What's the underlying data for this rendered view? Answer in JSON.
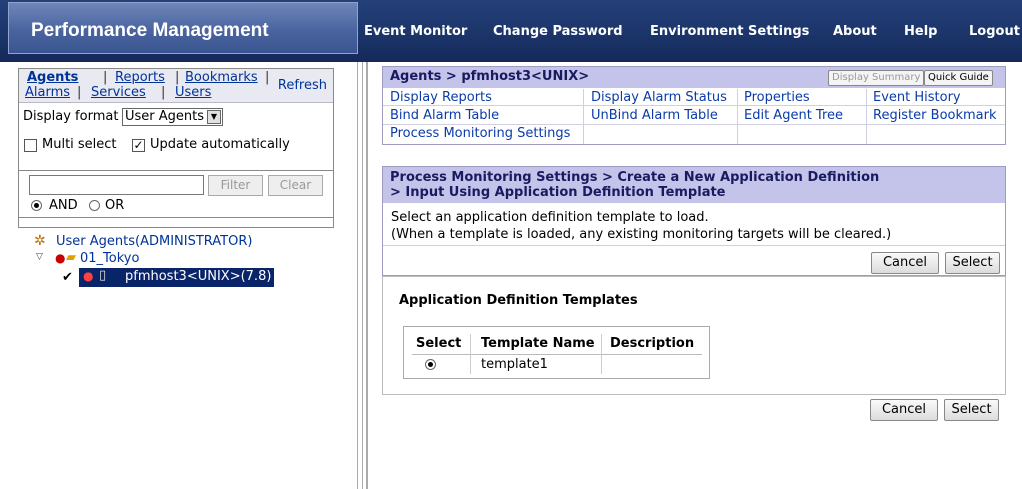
{
  "header": {
    "title": "Performance Management",
    "nav": [
      "Event Monitor",
      "Change Password",
      "Environment Settings",
      "About",
      "Help",
      "Logout"
    ]
  },
  "left": {
    "tabs_row1": [
      "Agents",
      "Reports",
      "Bookmarks"
    ],
    "tabs_row2": [
      "Alarms",
      "Services",
      "Users"
    ],
    "refresh": "Refresh",
    "display_format_label": "Display format",
    "display_format_value": "User Agents",
    "multi_select": "Multi select",
    "update_auto": "Update automatically",
    "filter_btn": "Filter",
    "clear_btn": "Clear",
    "and": "AND",
    "or": "OR",
    "tree": {
      "root": "User Agents(ADMINISTRATOR)",
      "folder": "01_Tokyo",
      "host": "pfmhost3<UNIX>(7.8)"
    }
  },
  "agent_panel": {
    "title": "Agents > pfmhost3<UNIX>",
    "display_summary": "Display Summary",
    "quick_guide": "Quick Guide",
    "links": [
      [
        "Display Reports",
        "Display Alarm Status",
        "Properties",
        "Event History"
      ],
      [
        "Bind Alarm Table",
        "UnBind Alarm Table",
        "Edit Agent Tree",
        "Register Bookmark"
      ],
      [
        "Process Monitoring Settings"
      ]
    ]
  },
  "process_panel": {
    "title_line1": "Process Monitoring Settings >  Create a New Application Definition",
    "title_line2": "> Input Using Application Definition Template",
    "desc1": "Select an application definition template to load.",
    "desc2": "(When a template is loaded, any existing monitoring targets will be cleared.)",
    "cancel": "Cancel",
    "select": "Select"
  },
  "templates": {
    "heading": "Application Definition Templates",
    "columns": [
      "Select",
      "Template Name",
      "Description"
    ],
    "rows": [
      {
        "name": "template1",
        "description": ""
      }
    ]
  }
}
